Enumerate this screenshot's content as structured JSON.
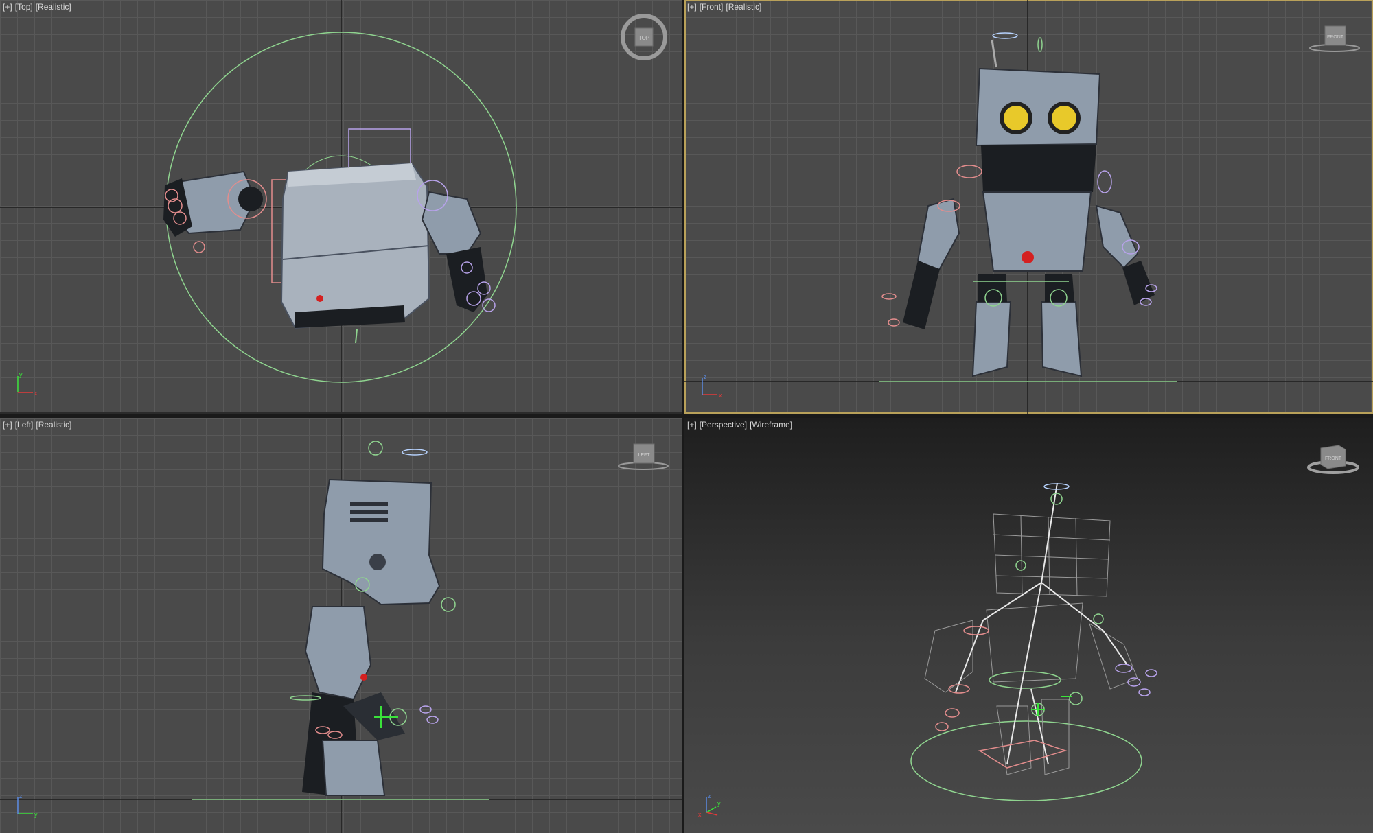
{
  "viewports": {
    "top": {
      "plus": "[+]",
      "view": "[Top]",
      "shading": "[Realistic]",
      "cube_label": "TOP"
    },
    "front": {
      "plus": "[+]",
      "view": "[Front]",
      "shading": "[Realistic]",
      "cube_label": "FRONT"
    },
    "left": {
      "plus": "[+]",
      "view": "[Left]",
      "shading": "[Realistic]",
      "cube_label": "LEFT"
    },
    "perspective": {
      "plus": "[+]",
      "view": "[Perspective]",
      "shading": "[Wireframe]",
      "cube_label": "FRONT"
    }
  },
  "colors": {
    "viewport_bg": "#4a4a4a",
    "grid_line": "#585858",
    "active_border": "#b9a15a",
    "helper_green": "#8fd48f",
    "bone_pink": "#e38d8d",
    "bone_violet": "#b7a2ea",
    "robot_body": "#8f9cab",
    "robot_dark": "#1b1e22",
    "eye_yellow": "#e8c92a",
    "nose_red": "#d42020"
  },
  "axis_labels": {
    "x": "x",
    "y": "y",
    "z": "z"
  }
}
